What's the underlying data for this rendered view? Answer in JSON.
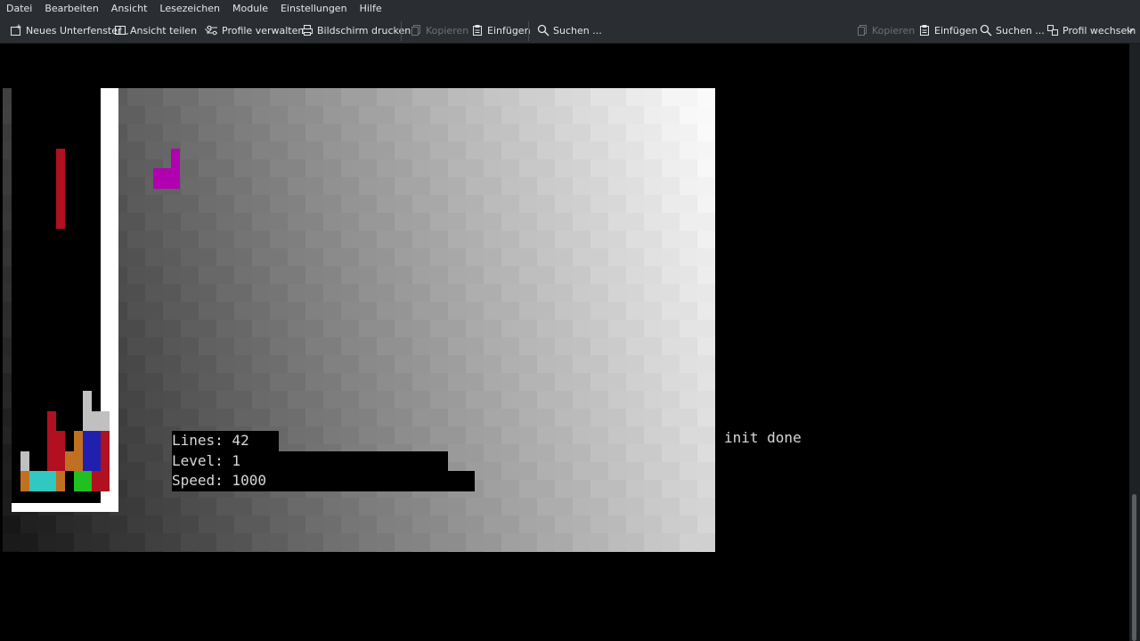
{
  "menu": [
    "Datei",
    "Bearbeiten",
    "Ansicht",
    "Lesezeichen",
    "Module",
    "Einstellungen",
    "Hilfe"
  ],
  "toolbar": {
    "new_tab": "Neues Unterfenster",
    "split_view": "Ansicht teilen",
    "manage_profiles": "Profile verwalten",
    "print_screen": "Bildschirm drucken",
    "copy": "Kopieren",
    "paste": "Einfügen",
    "find": "Suchen ...",
    "copy_right": "Kopieren",
    "paste_right": "Einfügen",
    "find_right": "Suchen ...",
    "switch_profile": "Profil wechseln"
  },
  "game": {
    "stats": {
      "lines": "Lines: 42",
      "level": "Level: 1",
      "speed": "Speed: 1000"
    },
    "status": "init done"
  },
  "colors": {
    "chrome_bg": "#2a2e32",
    "piece_red": "#b01020",
    "piece_magenta": "#b000b0",
    "piece_orange": "#c07020",
    "piece_blue": "#2020b0",
    "piece_cyan": "#30c8c0",
    "piece_green": "#20c020",
    "piece_gray": "#c0c0c0"
  }
}
